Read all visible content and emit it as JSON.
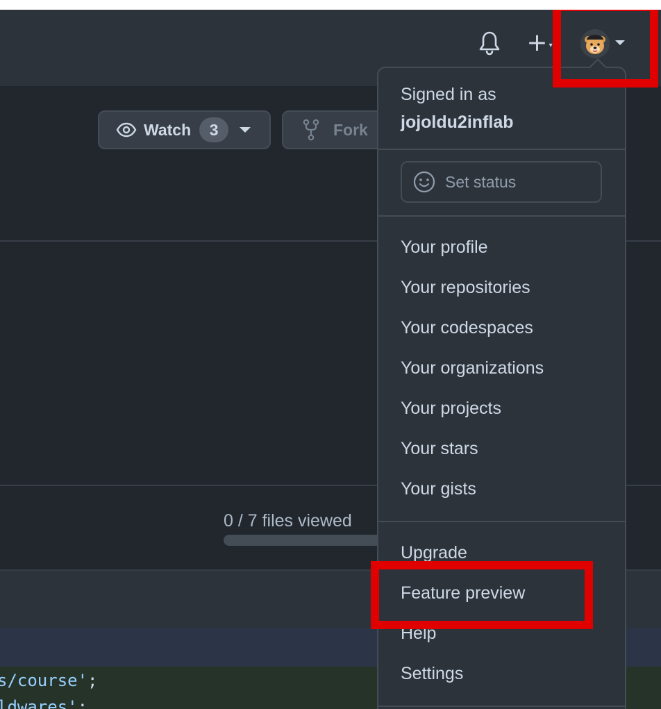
{
  "header": {
    "notifications_icon": "bell-icon",
    "create_icon": "plus-icon",
    "create_caret_icon": "caret-down-icon",
    "avatar_icon": "bear-avatar-icon",
    "avatar_caret_icon": "caret-down-icon"
  },
  "repo": {
    "watch_label": "Watch",
    "watch_count": "3",
    "fork_label": "Fork"
  },
  "review": {
    "files_viewed": "0 / 7 files viewed",
    "progress": 0
  },
  "code": {
    "line1_text": "s/course'",
    "line1_punc": ";",
    "line2_text": "ldwares'",
    "line2_punc": ";"
  },
  "user_menu": {
    "signed_in_label": "Signed in as",
    "username": "jojoldu2inflab",
    "set_status": "Set status",
    "items_group1": [
      "Your profile",
      "Your repositories",
      "Your codespaces",
      "Your organizations",
      "Your projects",
      "Your stars",
      "Your gists"
    ],
    "items_group2": [
      "Upgrade",
      "Feature preview",
      "Help",
      "Settings"
    ]
  },
  "colors": {
    "header_bg": "#2d333b",
    "page_bg": "#22272e",
    "menu_bg": "#2d333b",
    "highlight": "#e00000",
    "text": "#cdd9e5"
  }
}
